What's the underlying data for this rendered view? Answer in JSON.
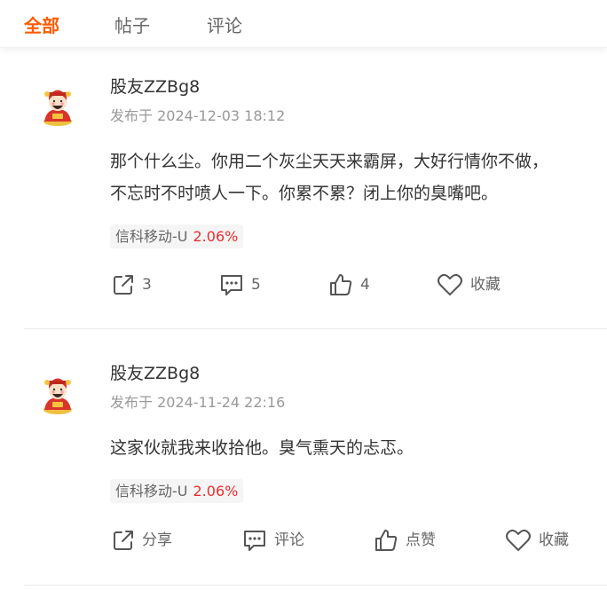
{
  "tabs": [
    {
      "label": "全部",
      "active": true
    },
    {
      "label": "帖子",
      "active": false
    },
    {
      "label": "评论",
      "active": false
    }
  ],
  "accent_color": "#ff5a00",
  "posts": [
    {
      "username": "股友ZZBg8",
      "timestamp": "发布于 2024-12-03 18:12",
      "content_lines": [
        "那个什么尘。你用二个灰尘天天来霸屏，大好行情你不做，",
        "不忘时不时喷人一下。你累不累？闭上你的臭嘴吧。"
      ],
      "stock": {
        "name": "信科移动-U",
        "change": "2.06%",
        "change_color": "#e52e2e"
      },
      "actions": {
        "share": "3",
        "comment": "5",
        "like": "4",
        "favorite": "收藏"
      }
    },
    {
      "username": "股友ZZBg8",
      "timestamp": "发布于 2024-11-24 22:16",
      "content_lines": [
        "这家伙就我来收拾他。臭气熏天的忐忑。"
      ],
      "stock": {
        "name": "信科移动-U",
        "change": "2.06%",
        "change_color": "#e52e2e"
      },
      "actions": {
        "share": "分享",
        "comment": "评论",
        "like": "点赞",
        "favorite": "收藏"
      }
    }
  ]
}
